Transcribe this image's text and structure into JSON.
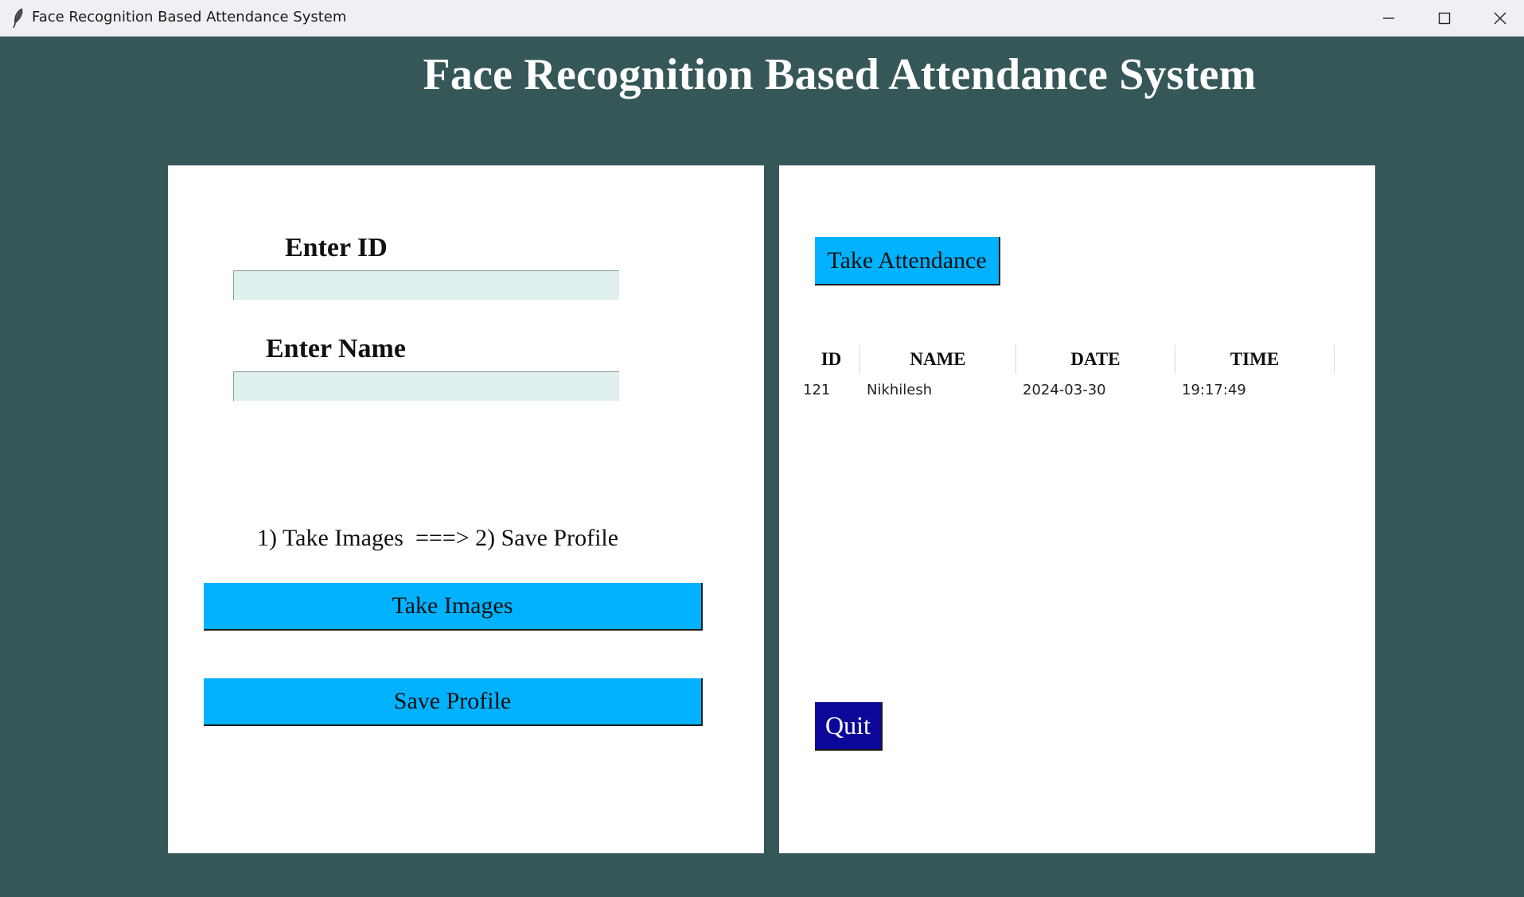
{
  "window": {
    "title": "Face Recognition Based Attendance System",
    "controls": [
      "minimize",
      "maximize",
      "close"
    ]
  },
  "heading": "Face Recognition Based Attendance System",
  "registration": {
    "id_label": "Enter ID",
    "id_value": "",
    "name_label": "Enter Name",
    "name_value": "",
    "instruction": "1) Take Images  ===> 2) Save Profile",
    "take_images_label": "Take Images",
    "save_profile_label": "Save Profile"
  },
  "attendance": {
    "take_attendance_label": "Take Attendance",
    "columns": [
      "ID",
      "NAME",
      "DATE",
      "TIME"
    ],
    "rows": [
      {
        "id": "121",
        "name": "Nikhilesh",
        "date": "2024-03-30",
        "time": "19:17:49"
      }
    ],
    "quit_label": "Quit"
  },
  "colors": {
    "background": "#365757",
    "button": "#00b2ff",
    "quit_button": "#0d0799",
    "entry": "#e0f0ef"
  },
  "icons": {
    "app": "feather-icon",
    "minimize": "minimize-icon",
    "maximize": "maximize-icon",
    "close": "close-icon"
  }
}
